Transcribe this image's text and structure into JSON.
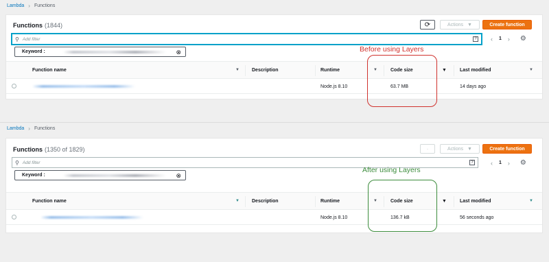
{
  "before": {
    "breadcrumb": {
      "root": "Lambda",
      "current": "Functions"
    },
    "title": "Functions",
    "count": "(1844)",
    "refresh_icon": "refresh-icon",
    "actions_label": "Actions",
    "create_label": "Create function",
    "filter_placeholder": "Add filter",
    "page_num": "1",
    "token_label": "Keyword :",
    "columns": {
      "name": "Function name",
      "description": "Description",
      "runtime": "Runtime",
      "code_size": "Code size",
      "last_modified": "Last modified"
    },
    "row": {
      "runtime": "Node.js 8.10",
      "code_size": "63.7 MB",
      "last_modified": "14 days ago"
    }
  },
  "after": {
    "breadcrumb": {
      "root": "Lambda",
      "current": "Functions"
    },
    "title": "Functions",
    "count": "(1350 of 1829)",
    "actions_label": "Actions",
    "create_label": "Create function",
    "filter_placeholder": "Add filter",
    "page_num": "1",
    "token_label": "Keyword :",
    "columns": {
      "name": "Function name",
      "description": "Description",
      "runtime": "Runtime",
      "code_size": "Code size",
      "last_modified": "Last modified"
    },
    "row": {
      "runtime": "Node.js 8.10",
      "code_size": "136.7 kB",
      "last_modified": "56 seconds ago"
    }
  },
  "annotations": {
    "before_label": "Before using Layers",
    "after_label": "After using Layers",
    "before_color": "#d0312d",
    "after_color": "#3c8c3c"
  },
  "colors": {
    "primary": "#ec7211",
    "link": "#0073bb",
    "focus": "#00a1c9"
  }
}
